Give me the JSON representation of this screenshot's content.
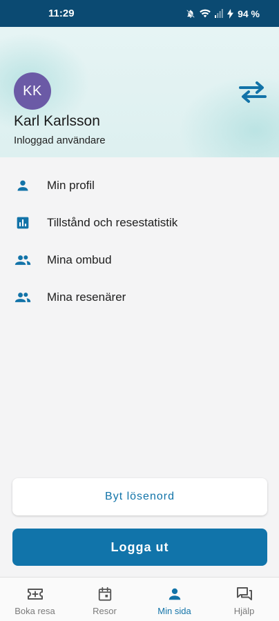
{
  "status_bar": {
    "time": "11:29",
    "battery": "94 %"
  },
  "header": {
    "avatar_initials": "KK",
    "user_name": "Karl Karlsson",
    "user_role": "Inloggad användare",
    "switch_icon": "swap-arrows-icon"
  },
  "menu": {
    "items": [
      {
        "label": "Min profil",
        "icon": "person-icon"
      },
      {
        "label": "Tillstånd och resestatistik",
        "icon": "bar-chart-icon"
      },
      {
        "label": "Mina ombud",
        "icon": "people-icon"
      },
      {
        "label": "Mina resenärer",
        "icon": "people-icon"
      }
    ]
  },
  "actions": {
    "change_password": "Byt lösenord",
    "logout": "Logga ut"
  },
  "bottom_nav": {
    "items": [
      {
        "label": "Boka resa",
        "icon": "ticket-add-icon",
        "active": false
      },
      {
        "label": "Resor",
        "icon": "calendar-icon",
        "active": false
      },
      {
        "label": "Min sida",
        "icon": "person-icon",
        "active": true
      },
      {
        "label": "Hjälp",
        "icon": "chat-icon",
        "active": false
      }
    ]
  },
  "colors": {
    "status_bar": "#0b4a72",
    "accent": "#1174aa",
    "avatar": "#6b5aa6",
    "header_bg": "#e6f4f4"
  }
}
